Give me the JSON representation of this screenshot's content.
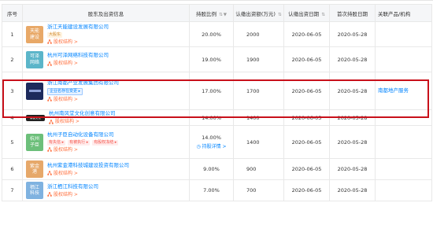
{
  "headers": {
    "index": "序号",
    "shareholder": "股东及出资信息",
    "ratio": "持股比例",
    "subscribed": "认缴出资额(万元)",
    "date": "认缴出资日期",
    "first_date": "首次持股日期",
    "products": "关联产品/机构"
  },
  "rows": [
    {
      "index": "1",
      "logo_text": "天能\n建设",
      "logo_color": "#e8a867",
      "name": "浙江天能建设发展有限公司",
      "tags": [
        "大股东"
      ],
      "tag_style": "gold",
      "structure": "股权结构 >",
      "ratio": "20.00%",
      "amount": "2000",
      "date": "2020-06-05",
      "first_date": "2020-05-28",
      "product": ""
    },
    {
      "index": "2",
      "logo_text": "可泽\n网络",
      "logo_color": "#5bb5c9",
      "name": "杭州可泽网络科技有限公司",
      "tags": [],
      "structure": "股权结构 >",
      "ratio": "19.00%",
      "amount": "1900",
      "date": "2020-06-05",
      "first_date": "2020-05-28",
      "product": ""
    },
    {
      "index": "3",
      "logo_text": "",
      "logo_color": "#1d2a5c",
      "name": "浙江南都产业发展集团有限公司",
      "tags": [
        "企业名存在变更 ▸"
      ],
      "tag_style": "blue",
      "structure": "股权结构 >",
      "ratio": "17.00%",
      "amount": "1700",
      "date": "2020-06-05",
      "first_date": "2020-05-28",
      "product": "南都地产服务"
    },
    {
      "index": "4",
      "logo_text": "南都文化",
      "logo_color": "#222222",
      "name": "杭州南风堂文化创意有限公司",
      "tags": [],
      "structure": "股权结构 >",
      "ratio": "14.00%",
      "amount": "1400",
      "date": "2020-06-05",
      "first_date": "2020-05-28",
      "product": ""
    },
    {
      "index": "5",
      "logo_text": "杭州\n子臣",
      "logo_color": "#6cbf7a",
      "name": "杭州子臣自动化设备有限公司",
      "tags": [
        "有失信 ▸",
        "有被执行 ▸",
        "有股权冻结 ▸"
      ],
      "tag_style": "red",
      "structure": "股权结构 >",
      "ratio": "14.00%",
      "detail": "持股详情 >",
      "amount": "1400",
      "date": "2020-06-05",
      "first_date": "2020-05-28",
      "product": ""
    },
    {
      "index": "6",
      "logo_text": "紫金\n港",
      "logo_color": "#e6a86a",
      "name": "杭州紫金港科技城建设投资有限公司",
      "tags": [],
      "structure": "股权结构 >",
      "ratio": "9.00%",
      "amount": "900",
      "date": "2020-06-05",
      "first_date": "2020-05-28",
      "product": ""
    },
    {
      "index": "7",
      "logo_text": "栖江\n科技",
      "logo_color": "#7fb2e0",
      "name": "浙江栖江科技有限公司",
      "tags": [],
      "structure": "股权结构 >",
      "ratio": "7.00%",
      "amount": "700",
      "date": "2020-06-05",
      "first_date": "2020-05-28",
      "product": ""
    }
  ]
}
